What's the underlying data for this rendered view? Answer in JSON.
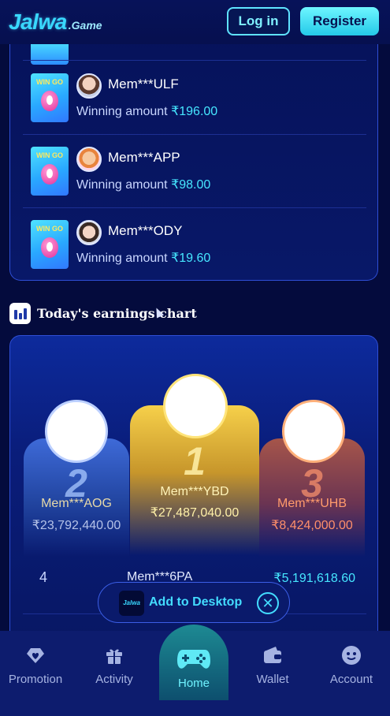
{
  "header": {
    "logo_main": "Jalwa",
    "logo_sub": ".Game",
    "login_label": "Log in",
    "register_label": "Register"
  },
  "winners": [
    {
      "name": "Mem***ULF",
      "label": "Winning amount",
      "amount": "₹196.00",
      "game_text": "WIN GO"
    },
    {
      "name": "Mem***APP",
      "label": "Winning amount",
      "amount": "₹98.00",
      "game_text": "WIN GO"
    },
    {
      "name": "Mem***ODY",
      "label": "Winning amount",
      "amount": "₹19.60",
      "game_text": "WIN GO"
    }
  ],
  "earnings": {
    "title": "Today's earnings chart",
    "top": [
      {
        "rank": "2",
        "name": "Mem***AOG",
        "amount": "₹23,792,440.00"
      },
      {
        "rank": "1",
        "name": "Mem***YBD",
        "amount": "₹27,487,040.00"
      },
      {
        "rank": "3",
        "name": "Mem***UHB",
        "amount": "₹8,424,000.00"
      }
    ],
    "rows": [
      {
        "rank": "4",
        "name": "Mem***6PA",
        "amount": "₹5,191,618.60"
      }
    ]
  },
  "add_desktop": {
    "logo_text": "Jalwa",
    "label": "Add to Desktop"
  },
  "nav": {
    "promotion": "Promotion",
    "activity": "Activity",
    "home": "Home",
    "wallet": "Wallet",
    "account": "Account"
  },
  "icons": {
    "promotion": "diamond-heart-icon",
    "activity": "gift-icon",
    "home": "gamepad-icon",
    "wallet": "wallet-icon",
    "account": "user-face-icon"
  },
  "colors": {
    "background": "#040b3d",
    "accent": "#46e7ff",
    "gold": "#f6d04a",
    "bronze": "#ff8f6a"
  }
}
